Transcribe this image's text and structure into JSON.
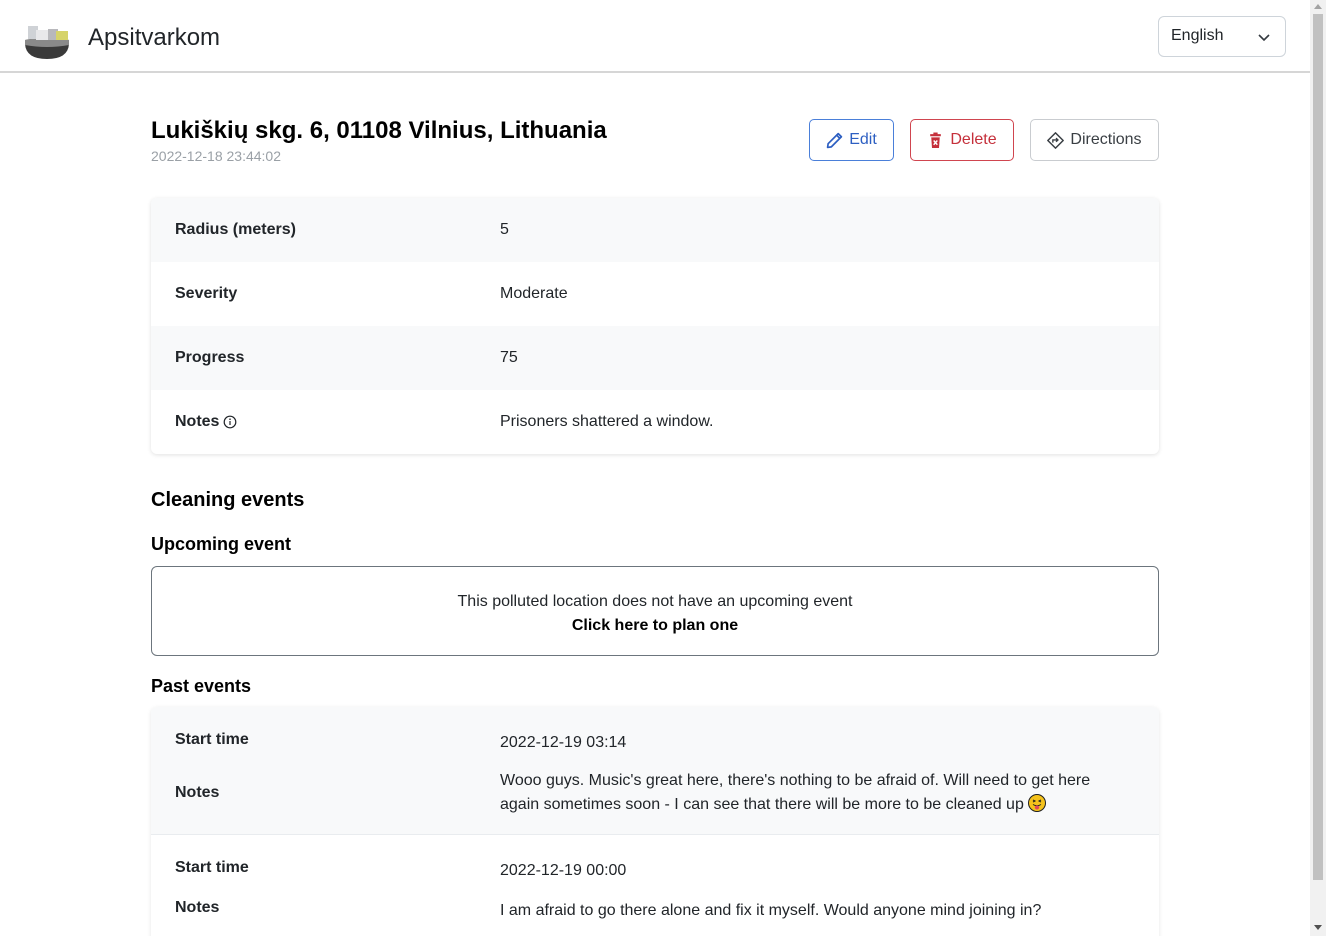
{
  "app": {
    "brand": "Apsitvarkom",
    "language": "English"
  },
  "location": {
    "title": "Lukiškių skg. 6, 01108 Vilnius, Lithuania",
    "timestamp": "2022-12-18 23:44:02"
  },
  "actions": {
    "edit_label": "Edit",
    "delete_label": "Delete",
    "directions_label": "Directions"
  },
  "details": [
    {
      "label": "Radius (meters)",
      "value": "5"
    },
    {
      "label": "Severity",
      "value": "Moderate"
    },
    {
      "label": "Progress",
      "value": "75"
    },
    {
      "label": "Notes",
      "value": "Prisoners shattered a window."
    }
  ],
  "events": {
    "section_title": "Cleaning events",
    "upcoming_title": "Upcoming event",
    "upcoming_empty": "This polluted location does not have an upcoming event",
    "upcoming_cta": "Click here to plan one",
    "past_title": "Past events",
    "past": [
      {
        "start_label": "Start time",
        "start_value": "2022-12-19 03:14",
        "notes_label": "Notes",
        "notes_value": "Wooo guys. Music's great here, there's nothing to be afraid of. Will need to get here again sometimes soon - I can see that there will be more to be cleaned up"
      },
      {
        "start_label": "Start time",
        "start_value": "2022-12-19 00:00",
        "notes_label": "Notes",
        "notes_value": "I am afraid to go there alone and fix it myself. Would anyone mind joining in?"
      }
    ]
  },
  "icons": {
    "logo": "trash-bin-logo-icon",
    "edit": "pencil-icon",
    "delete": "trash-icon",
    "directions": "directions-sign-icon",
    "notes_info": "info-circle-icon",
    "emoji": "tongue-out-emoji-icon",
    "lang_chevron": "chevron-down-icon"
  },
  "colors": {
    "edit": "#2d5fc2",
    "delete": "#c5303b",
    "striped_row": "#f8f9fa"
  }
}
